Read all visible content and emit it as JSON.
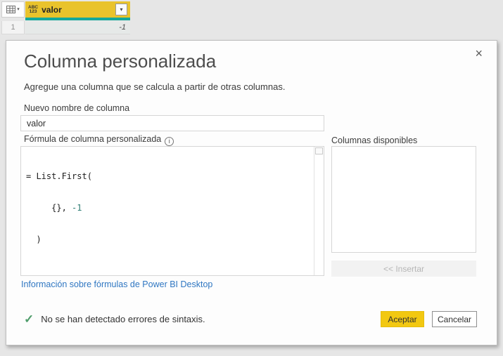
{
  "table": {
    "column": {
      "type_icon_top": "ABC",
      "type_icon_bottom": "123",
      "name": "valor",
      "filter_icon": "▾"
    },
    "corner_caret": "▾",
    "rows": [
      {
        "index": "1",
        "value": "-1"
      }
    ],
    "header_color": "#e9c32c",
    "accent_color": "#15a89b"
  },
  "dialog": {
    "close_icon": "×",
    "title": "Columna personalizada",
    "subtitle": "Agregue una columna que se calcula a partir de otras columnas.",
    "new_column_name": {
      "label": "Nuevo nombre de columna",
      "value": "valor"
    },
    "formula": {
      "label": "Fórmula de columna personalizada",
      "info_icon": "i",
      "code": {
        "line1": "= List.First(",
        "line2_pre": "     {}, ",
        "line2_num": "-1",
        "line3": "  )"
      },
      "number_color": "#2e7d74"
    },
    "available_columns": {
      "label": "Columnas disponibles",
      "items": []
    },
    "insert_button": {
      "label": "<< Insertar",
      "enabled": false
    },
    "help_link": "Información sobre fórmulas de Power BI Desktop",
    "status": {
      "icon": "✓",
      "message": "No se han detectado errores de sintaxis."
    },
    "accept_button": "Aceptar",
    "cancel_button": "Cancelar",
    "accent_yellow": "#f2c811"
  }
}
